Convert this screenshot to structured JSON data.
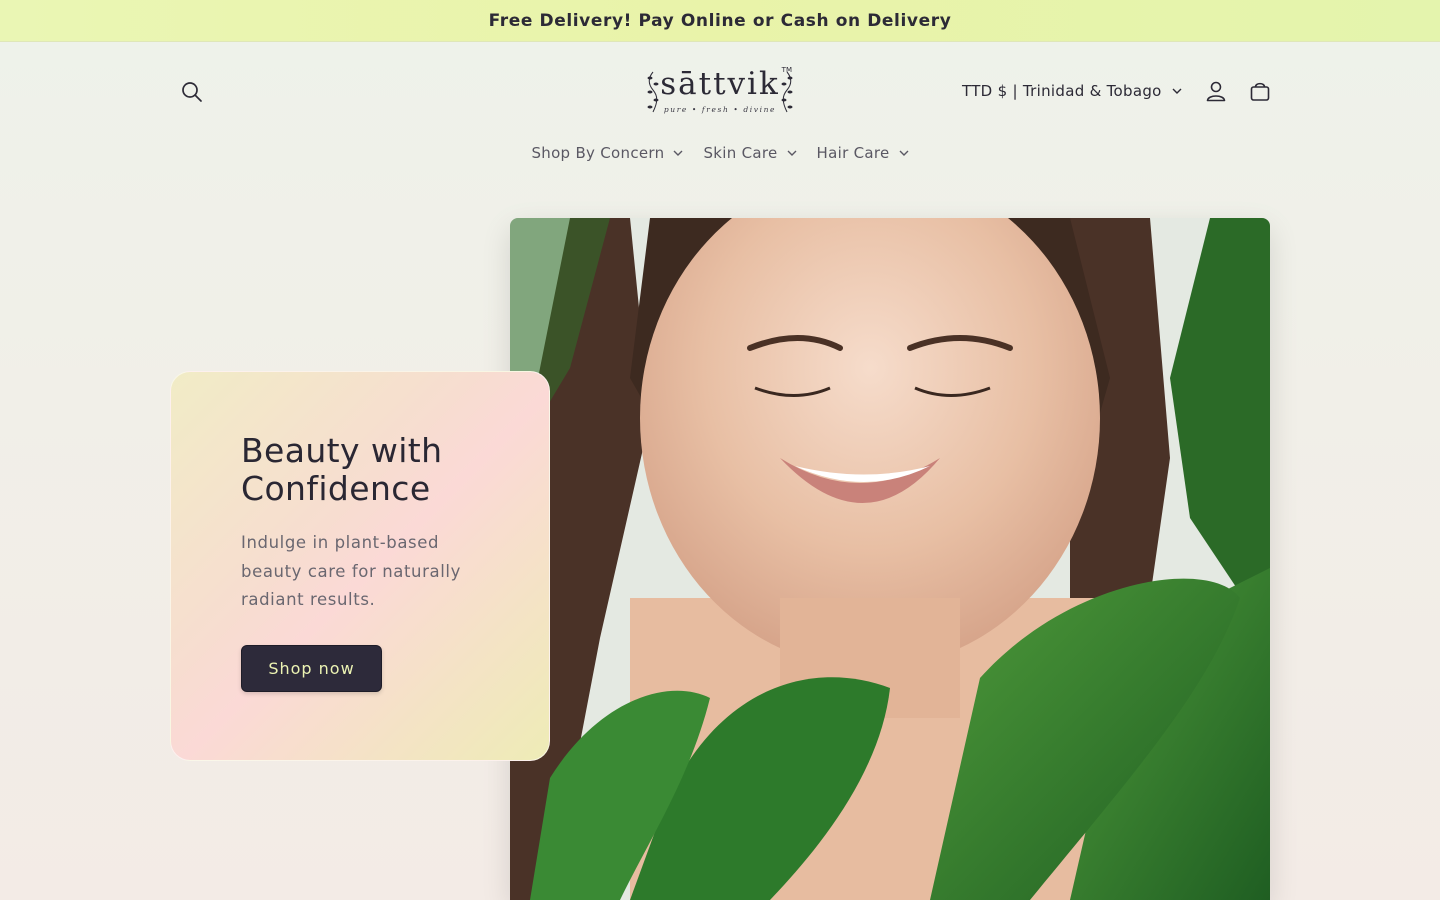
{
  "announcement": {
    "text": "Free Delivery! Pay Online or Cash on Delivery"
  },
  "header": {
    "logo": {
      "word": "sāttvik",
      "tagline": "pure • fresh • divine",
      "tm": "TM"
    },
    "currency": "TTD $ | Trinidad & Tobago",
    "icons": [
      "search-icon",
      "account-icon",
      "cart-icon"
    ]
  },
  "nav": {
    "items": [
      {
        "label": "Shop By Concern"
      },
      {
        "label": "Skin Care"
      },
      {
        "label": "Hair Care"
      }
    ]
  },
  "hero": {
    "title": "Beauty with Confidence",
    "description": "Indulge in plant-based beauty care for naturally radiant results.",
    "cta_label": "Shop now"
  },
  "colors": {
    "announcement_bg": "#e9f4ab",
    "button_bg": "#2d2a3a",
    "button_text": "#ecf3b3",
    "text_dark": "#2a2733"
  }
}
